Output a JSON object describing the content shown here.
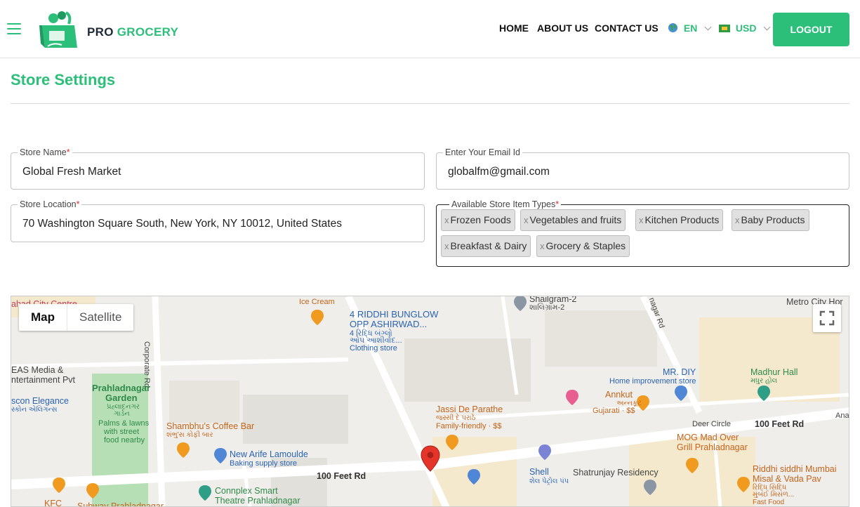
{
  "header": {
    "logo_pro": "PRO",
    "logo_grocery": "GROCERY",
    "nav": [
      "HOME",
      "ABOUT US",
      "CONTACT US"
    ],
    "language": "EN",
    "currency": "USD",
    "logout_label": "LOGOUT"
  },
  "page": {
    "title": "Store Settings"
  },
  "form": {
    "store_name_label": "Store Name",
    "store_name_value": "Global Fresh Market",
    "email_label": "Enter Your Email Id",
    "email_value": "globalfm@gmail.com",
    "location_label": "Store Location",
    "location_value": "70 Washington Square South, New York, NY 10012, United States",
    "item_types_label": "Available Store Item Types",
    "required_mark": "*",
    "chip_remove": "x",
    "item_types": [
      "Frozen Foods",
      "Vegetables and fruits",
      "Kitchen Products",
      "Baby Products",
      "Breakfast & Dairy",
      "Grocery & Staples"
    ]
  },
  "map": {
    "map_button": "Map",
    "satellite_button": "Satellite",
    "labels": {
      "city_centre": "ahad City Centre",
      "ice_cream": "Ice Cream",
      "riddhi_1": "4 RIDDHI BUNGLOW",
      "riddhi_2": "OPP ASHIRWAD...",
      "riddhi_gu1": "4 રિદ્ધિ બંગ્લો",
      "riddhi_gu2": "ઓપ આશીર્વાદ...",
      "clothing": "Clothing store",
      "shailgram": "Shailgram-2",
      "shailgram_gu": "શાલિગ્રામ-2",
      "metro_city": "Metro City Hor",
      "corporate_rd": "Corporate Rd",
      "nagar_rd": "nagar Rd",
      "eas_media": "EAS Media &",
      "entertainment": "ntertainment Pvt",
      "prahladnagar_garden": "Prahladnagar",
      "garden": "Garden",
      "garden_gu1": "પ્રહ્લાદનગર",
      "garden_gu2": "ગાર્ડન",
      "palms_1": "Palms & lawns",
      "palms_2": "with street",
      "palms_3": "food nearby",
      "elegance": "scon Elegance",
      "elegance_gu": "સ્કોન એલિગન્સ",
      "mr_diy": "MR. DIY",
      "home_improvement": "Home improvement store",
      "madhur_hall": "Madhur Hall",
      "madhur_gu": "મધુર હોલ",
      "annkut": "Annkut",
      "annkut_gu": "અન્નકૂટ",
      "gujarati": "Gujarati · $$",
      "jassi": "Jassi De Parathe",
      "jassi_gu": "જસ્સી દે પરાઠે",
      "family_friendly": "Family-friendly · $$",
      "shambhu": "Shambhu's Coffee Bar",
      "shambhu_gu": "શંભુ'સ કોફી બાર",
      "deer_circle": "Deer Circle",
      "feet_rd_east": "100 Feet Rd",
      "anar": "Anar",
      "new_arife": "New Arife Lamoulde",
      "baking": "Baking supply store",
      "mog_1": "MOG Mad Over",
      "mog_2": "Grill Prahladnagar",
      "feet_rd_west": "100 Feet Rd",
      "shell": "Shell",
      "shell_gu": "શેલ પેટ્રોલ પંપ",
      "shatrunjay": "Shatrunjay Residency",
      "riddhi_siddhi_1": "Riddhi siddhi Mumbai",
      "riddhi_siddhi_2": "Misal & Vada Pav",
      "riddhi_siddhi_gu1": "રિદ્ધિ સિદ્ધિ",
      "riddhi_siddhi_gu2": "મુંબઈ મિસળ...",
      "fast_food": "Fast Food",
      "connplex_1": "Connplex Smart",
      "connplex_2": "Theatre Prahladnagar",
      "kfc": "KFC",
      "subway": "Subway Prahladnagar"
    }
  },
  "colors": {
    "brand": "#2cbf7a",
    "required": "#d32f2f",
    "map_pin": "#e5352b"
  },
  "icons": [
    "menu-icon",
    "grocery-bag-logo",
    "globe-icon",
    "flag-icon",
    "chevron-down-icon",
    "fullscreen-icon",
    "map-pin-icon"
  ]
}
